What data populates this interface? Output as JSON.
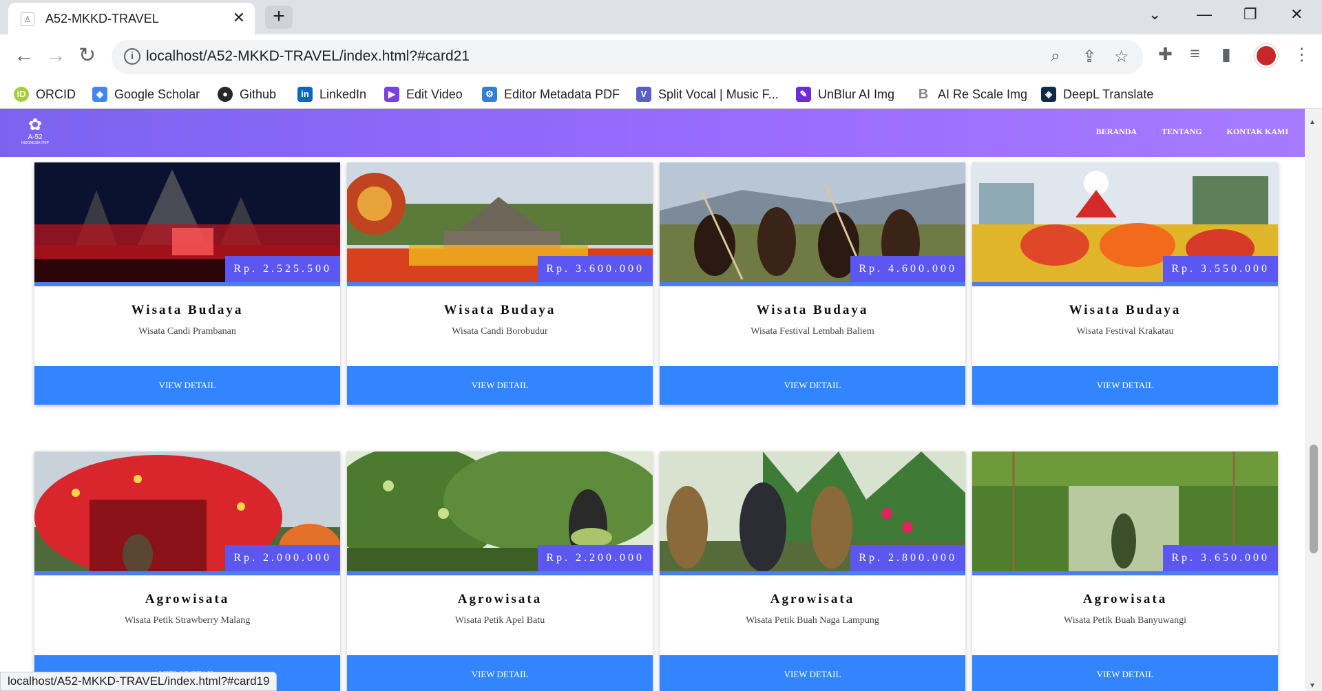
{
  "browser": {
    "tab_title": "A52-MKKD-TRAVEL",
    "url": "localhost/A52-MKKD-TRAVEL/index.html?#card21",
    "status_url": "localhost/A52-MKKD-TRAVEL/index.html?#card19",
    "bookmarks": [
      {
        "label": "ORCID",
        "icon": "orcid-icon",
        "color": "#a6ce39"
      },
      {
        "label": "Google Scholar",
        "icon": "google-scholar-icon",
        "color": "#4285f4"
      },
      {
        "label": "Github",
        "icon": "github-icon",
        "color": "#24292e"
      },
      {
        "label": "LinkedIn",
        "icon": "linkedin-icon",
        "color": "#0a66c2"
      },
      {
        "label": "Edit Video",
        "icon": "edit-video-icon",
        "color": "#7b3fe4"
      },
      {
        "label": "Editor Metadata PDF",
        "icon": "metadata-pdf-icon",
        "color": "#2f7fd8"
      },
      {
        "label": "Split Vocal | Music F...",
        "icon": "split-vocal-icon",
        "color": "#5b5fc7"
      },
      {
        "label": "UnBlur AI Img",
        "icon": "unblur-icon",
        "color": "#6b2bd9"
      },
      {
        "label": "AI Re Scale Img",
        "icon": "rescale-icon",
        "color": "#888888"
      },
      {
        "label": "DeepL Translate",
        "icon": "deepl-icon",
        "color": "#0f2b46"
      }
    ]
  },
  "site": {
    "logo_text": "A-52",
    "logo_sub": "INDONESIA TRIP",
    "nav": [
      "BERANDA",
      "TENTANG",
      "KONTAK KAMI"
    ],
    "accent": "#8b68ff",
    "button_color": "#3285ff"
  },
  "cards": [
    {
      "price": "Rp. 2.525.500",
      "title": "Wisata Budaya",
      "subtitle": "Wisata Candi Prambanan",
      "button": "VIEW DETAIL",
      "scene": "temple-night"
    },
    {
      "price": "Rp. 3.600.000",
      "title": "Wisata Budaya",
      "subtitle": "Wisata Candi Borobudur",
      "button": "VIEW DETAIL",
      "scene": "borobudur"
    },
    {
      "price": "Rp. 4.600.000",
      "title": "Wisata Budaya",
      "subtitle": "Wisata Festival Lembah Baliem",
      "button": "VIEW DETAIL",
      "scene": "baliem"
    },
    {
      "price": "Rp. 3.550.000",
      "title": "Wisata Budaya",
      "subtitle": "Wisata Festival Krakatau",
      "button": "VIEW DETAIL",
      "scene": "krakatau"
    },
    {
      "price": "Rp. 2.000.000",
      "title": "Agrowisata",
      "subtitle": "Wisata Petik Strawberry Malang",
      "button": "VIEW DETAIL",
      "scene": "strawberry"
    },
    {
      "price": "Rp. 2.200.000",
      "title": "Agrowisata",
      "subtitle": "Wisata Petik Apel Batu",
      "button": "VIEW DETAIL",
      "scene": "apple"
    },
    {
      "price": "Rp. 2.800.000",
      "title": "Agrowisata",
      "subtitle": "Wisata Petik Buah Naga Lampung",
      "button": "VIEW DETAIL",
      "scene": "dragonfruit"
    },
    {
      "price": "Rp. 3.650.000",
      "title": "Agrowisata",
      "subtitle": "Wisata Petik Buah Banyuwangi",
      "button": "VIEW DETAIL",
      "scene": "greenhouse"
    }
  ]
}
